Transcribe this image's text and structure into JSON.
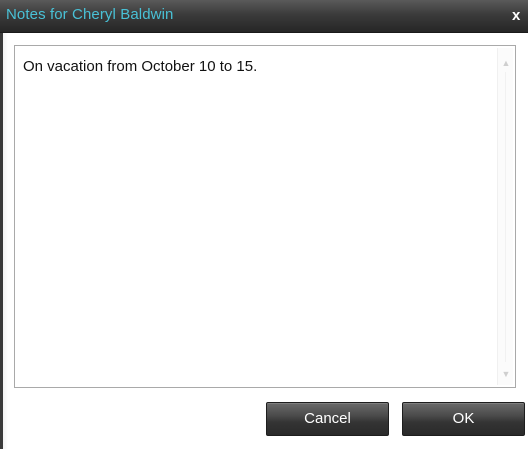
{
  "dialog": {
    "title": "Notes for Cheryl Baldwin",
    "close_label": "x"
  },
  "notes": {
    "value": "On vacation from October 10 to 15."
  },
  "buttons": {
    "cancel_label": "Cancel",
    "ok_label": "OK"
  },
  "colors": {
    "title_text": "#49c1d6",
    "titlebar_bg": "#3b3b3b",
    "button_bg": "#3a3a3a",
    "button_text": "#ffffff"
  },
  "icons": {
    "close": "close-icon",
    "scroll_up": "scroll-up-arrow-icon",
    "scroll_down": "scroll-down-arrow-icon"
  }
}
